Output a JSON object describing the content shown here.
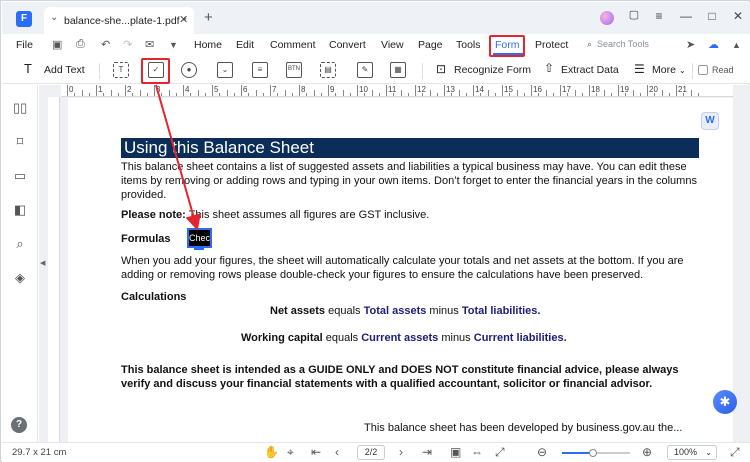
{
  "window": {
    "app_logo": "F",
    "tab_title": "balance-she...plate-1.pdf *",
    "controls": [
      "—",
      "□",
      "✕"
    ]
  },
  "menu": {
    "file": "File",
    "items": [
      "Home",
      "Edit",
      "Comment",
      "Convert",
      "View",
      "Page",
      "Tools",
      "Form",
      "Protect"
    ],
    "active": "Form",
    "search_placeholder": "Search Tools"
  },
  "toolbar": {
    "add_text": "Add Text",
    "recognize_form": "Recognize Form",
    "extract_data": "Extract Data",
    "more": "More",
    "read": "Read"
  },
  "ruler": {
    "numbers": [
      "0",
      "1",
      "2",
      "3",
      "4",
      "5",
      "6",
      "7",
      "8",
      "9",
      "10",
      "11",
      "12",
      "13",
      "14",
      "15",
      "16",
      "17",
      "18",
      "19",
      "20",
      "21"
    ]
  },
  "document": {
    "heading": "Using this Balance Sheet",
    "intro": "This balance sheet contains a list of suggested assets and liabilities a typical business may have. You can edit these items by removing or adding rows and typing in your own items. Don’t forget to enter the financial years in the columns provided.",
    "please_note_label": "Please note:",
    "please_note_text": " This sheet assumes all figures are GST inclusive.",
    "formulas_label": "Formulas",
    "check_field_text": "Chec",
    "auto_calc": "When you add your figures, the sheet will automatically calculate your totals and net assets at the bottom. If you are adding or removing rows please double-check your figures to ensure the calculations have been preserved.",
    "calculations_label": "Calculations",
    "net_assets": {
      "term": "Net assets",
      "equals": " equals ",
      "a": "Total assets",
      "minus": " minus ",
      "b": "Total liabilities."
    },
    "working_capital": {
      "term": "Working capital",
      "equals": " equals ",
      "a": "Current assets",
      "minus": " minus ",
      "b": "Current liabilities."
    },
    "disclaimer": "This balance sheet is intended as a GUIDE ONLY and DOES NOT constitute financial advice, please always verify and discuss your financial statements with a qualified accountant, solicitor or financial advisor.",
    "footer_partial": "This balance sheet has been developed by business.gov.au the..."
  },
  "status": {
    "page_size": "29.7 x 21 cm",
    "current_page": "2",
    "total_pages": "/2",
    "zoom": "100%",
    "zoom_level": 0.45
  },
  "colors": {
    "accent": "#2c6df5",
    "highlight": "#e3262e",
    "heading_bg": "#0b2d58"
  }
}
